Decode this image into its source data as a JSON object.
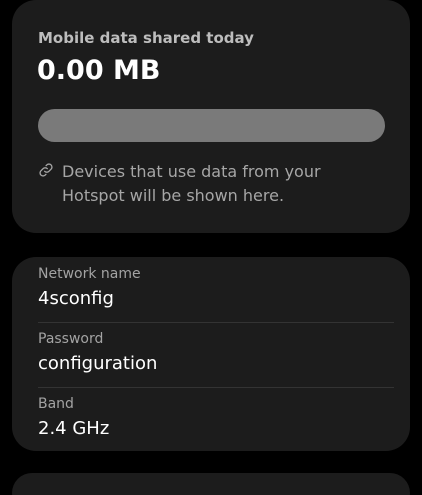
{
  "usage": {
    "title": "Mobile data shared today",
    "value": "0.00 MB",
    "progress_fraction": 0,
    "info_icon": "link-icon",
    "info_text": "Devices that use data from your Hotspot will be shown here."
  },
  "network": {
    "name_label": "Network name",
    "name_value": "4sconfig",
    "password_label": "Password",
    "password_value": "configuration",
    "band_label": "Band",
    "band_value": "2.4 GHz"
  },
  "colors": {
    "background": "#000000",
    "card": "#1c1c1c",
    "bar_track": "#7a7a7a"
  }
}
